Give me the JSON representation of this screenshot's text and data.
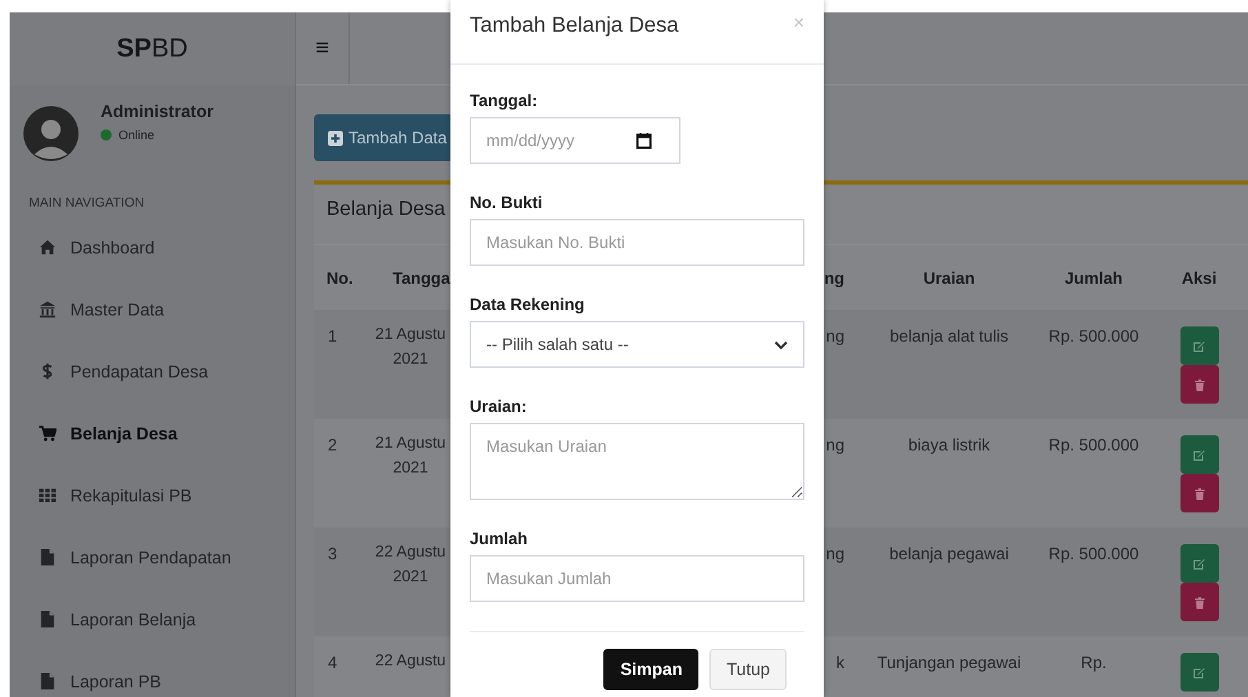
{
  "app": {
    "logo_bold": "SP",
    "logo_rest": "BD",
    "menu_icon": "≡"
  },
  "user": {
    "name": "Administrator",
    "status": "Online"
  },
  "sidebar": {
    "heading": "MAIN NAVIGATION",
    "items": [
      {
        "label": "Dashboard",
        "selected": false
      },
      {
        "label": "Master Data",
        "selected": false
      },
      {
        "label": "Pendapatan Desa",
        "selected": false
      },
      {
        "label": "Belanja Desa",
        "selected": true
      },
      {
        "label": "Rekapitulasi PB",
        "selected": false
      },
      {
        "label": "Laporan Pendapatan",
        "selected": false
      },
      {
        "label": "Laporan Belanja",
        "selected": false
      },
      {
        "label": "Laporan PB",
        "selected": false
      }
    ]
  },
  "content": {
    "add_button": "Tambah Data",
    "card_title": "Belanja Desa",
    "table": {
      "columns": [
        "No.",
        "Tangga",
        "ng",
        "Uraian",
        "Jumlah",
        "Aksi"
      ],
      "rows": [
        {
          "no": "1",
          "date": [
            "21 Agustu",
            "2021"
          ],
          "rekening": "ng",
          "uraian": "belanja alat tulis",
          "jumlah": "Rp. 500.000",
          "delete_button": true
        },
        {
          "no": "2",
          "date": [
            "21 Agustu",
            "2021"
          ],
          "rekening": "ng",
          "uraian": "biaya listrik",
          "jumlah": "Rp. 500.000",
          "delete_button": true
        },
        {
          "no": "3",
          "date": [
            "22 Agustu",
            "2021"
          ],
          "rekening": "ng",
          "uraian": "belanja pegawai",
          "jumlah": "Rp. 500.000",
          "delete_button": true
        },
        {
          "no": "4",
          "date": [
            "22 Agustu"
          ],
          "rekening": "k",
          "uraian": "Tunjangan pegawai",
          "jumlah": "Rp."
        }
      ]
    }
  },
  "modal": {
    "title": "Tambah Belanja Desa",
    "close": "×",
    "fields": [
      {
        "kind": "date",
        "label": "Tanggal:",
        "placeholder": "mm/dd/yyyy"
      },
      {
        "kind": "text",
        "label": "No. Bukti",
        "placeholder": "Masukan No. Bukti"
      },
      {
        "kind": "select",
        "label": "Data Rekening",
        "value": "-- Pilih salah satu --"
      },
      {
        "kind": "textarea",
        "label": "Uraian:",
        "placeholder": "Masukan Uraian"
      },
      {
        "kind": "text",
        "label": "Jumlah",
        "placeholder": "Masukan Jumlah"
      }
    ],
    "buttons": [
      {
        "label": "Simpan",
        "kind": "primary"
      },
      {
        "label": "Tutup",
        "kind": "default"
      }
    ]
  }
}
